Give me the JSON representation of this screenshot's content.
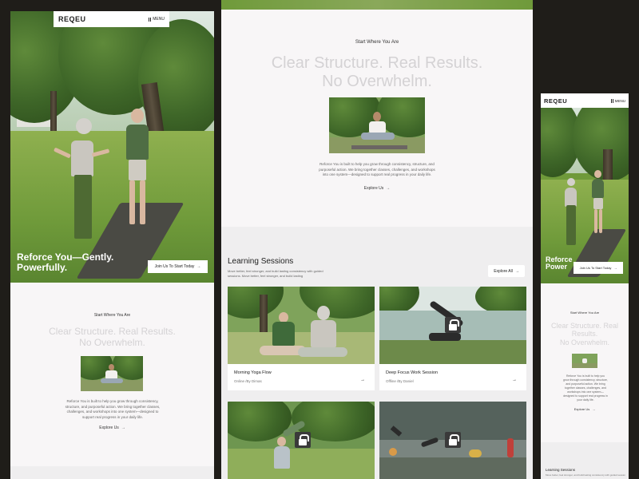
{
  "brand": {
    "logo": "REQEU",
    "menu_label": "MENU"
  },
  "hero": {
    "title_line1": "Reforce You—Gently.",
    "title_line2": "Powerfully.",
    "cta": "Join Us To Start Today",
    "cta_arrow": "→"
  },
  "intro": {
    "eyebrow": "Start Where You Are",
    "title_line1": "Clear Structure. Real Results.",
    "title_line2": "No Overwhelm.",
    "body": "Reforce You is built to help you grow through consistency, structure, and purposeful action. We bring together classes, challenges, and workshops into one system—designed to support real progress in your daily life.",
    "explore": "Explore Us",
    "explore_arrow": "→"
  },
  "mobile_hero": {
    "title_line1": "Reforce",
    "title_line2": "Power"
  },
  "sessions": {
    "title": "Learning Sessions",
    "subtitle": "Move better, feel stronger, and build lasting consistency with guided sessions. Move better, feel stronger, and build lasting",
    "explore_all": "Explore All",
    "explore_arrow": "→",
    "cards": [
      {
        "title": "Morning Yoga Flow",
        "meta": "Online /By Dimas",
        "arrow": "→"
      },
      {
        "title": "Deep Focus Work Session",
        "meta": "Offline /By Daniel",
        "arrow": "→"
      }
    ]
  },
  "colors": {
    "accent_text": "#d4d2d4",
    "panel_bg": "#f8f6f7",
    "backdrop": "#1f1d19"
  },
  "icons": [
    "menu-icon",
    "arrow-right-icon",
    "lock-icon"
  ]
}
